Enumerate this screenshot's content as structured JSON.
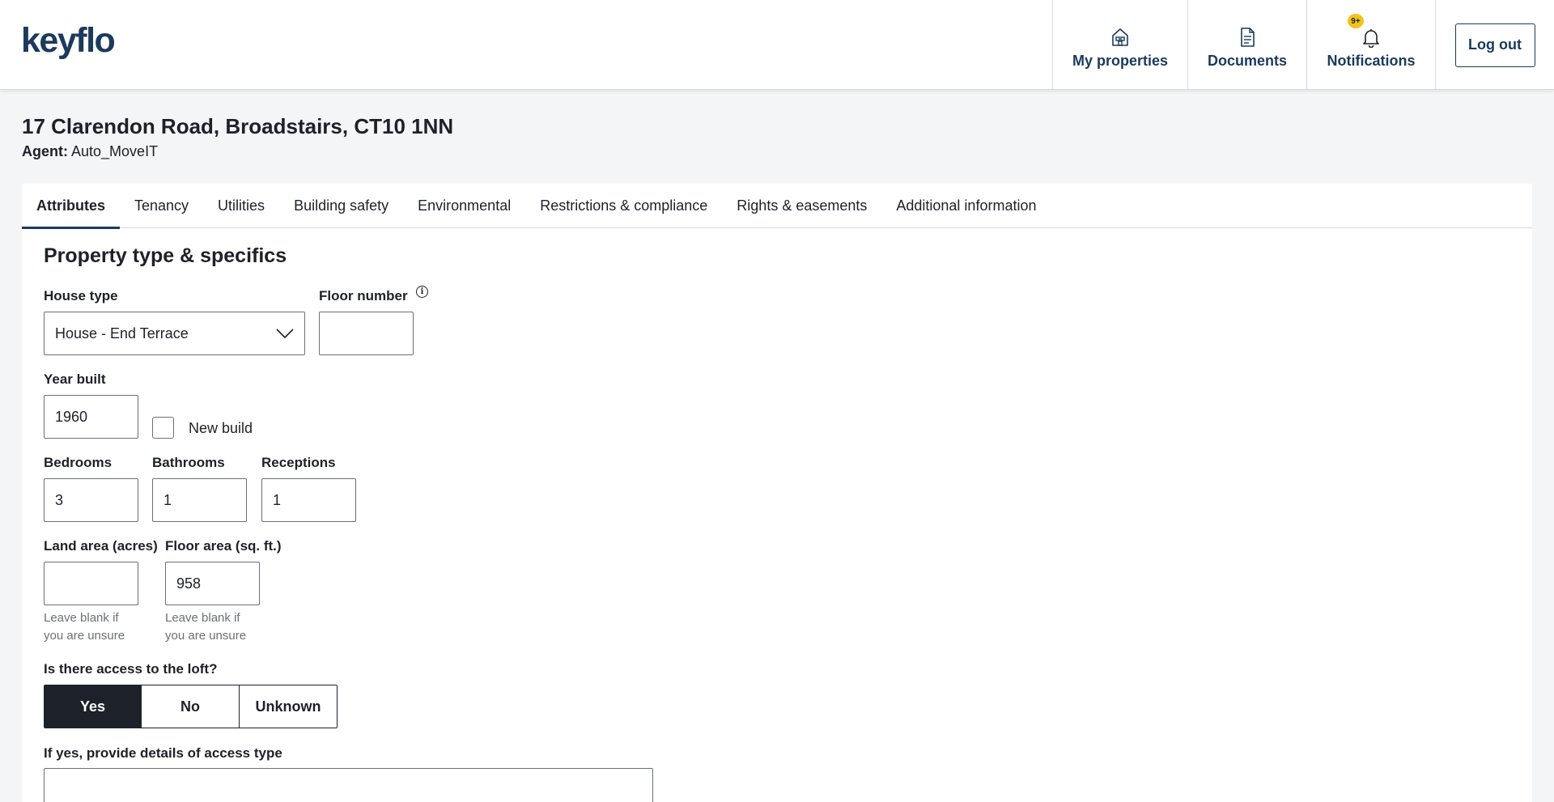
{
  "brand": {
    "logo": "keyflo"
  },
  "nav": {
    "items": [
      {
        "label": "My properties",
        "icon": "house-icon"
      },
      {
        "label": "Documents",
        "icon": "document-icon"
      },
      {
        "label": "Notifications",
        "icon": "bell-icon",
        "badge": "9+"
      }
    ],
    "logout": "Log out"
  },
  "property": {
    "title": "17 Clarendon Road, Broadstairs, CT10 1NN",
    "agent_label": "Agent:",
    "agent_name": "Auto_MoveIT"
  },
  "tabs": [
    "Attributes",
    "Tenancy",
    "Utilities",
    "Building safety",
    "Environmental",
    "Restrictions & compliance",
    "Rights & easements",
    "Additional information"
  ],
  "active_tab": "Attributes",
  "form": {
    "section_title": "Property type & specifics",
    "house_type": {
      "label": "House type",
      "value": "House - End Terrace"
    },
    "floor_number": {
      "label": "Floor number",
      "value": ""
    },
    "year_built": {
      "label": "Year built",
      "value": "1960"
    },
    "new_build": {
      "label": "New build",
      "checked": false
    },
    "bedrooms": {
      "label": "Bedrooms",
      "value": "3"
    },
    "bathrooms": {
      "label": "Bathrooms",
      "value": "1"
    },
    "receptions": {
      "label": "Receptions",
      "value": "1"
    },
    "land_area": {
      "label": "Land area (acres)",
      "value": "",
      "help": "Leave blank if you are unsure"
    },
    "floor_area": {
      "label": "Floor area (sq. ft.)",
      "value": "958",
      "help": "Leave blank if you are unsure"
    },
    "loft_access": {
      "label": "Is there access to the loft?",
      "options": [
        "Yes",
        "No",
        "Unknown"
      ],
      "selected": "Yes"
    },
    "access_details": {
      "label": "If yes, provide details of access type",
      "value": ""
    }
  },
  "colors": {
    "brand_navy": "#1b3a5c",
    "badge_yellow": "#f3c318",
    "selected_dark": "#1d2129"
  }
}
